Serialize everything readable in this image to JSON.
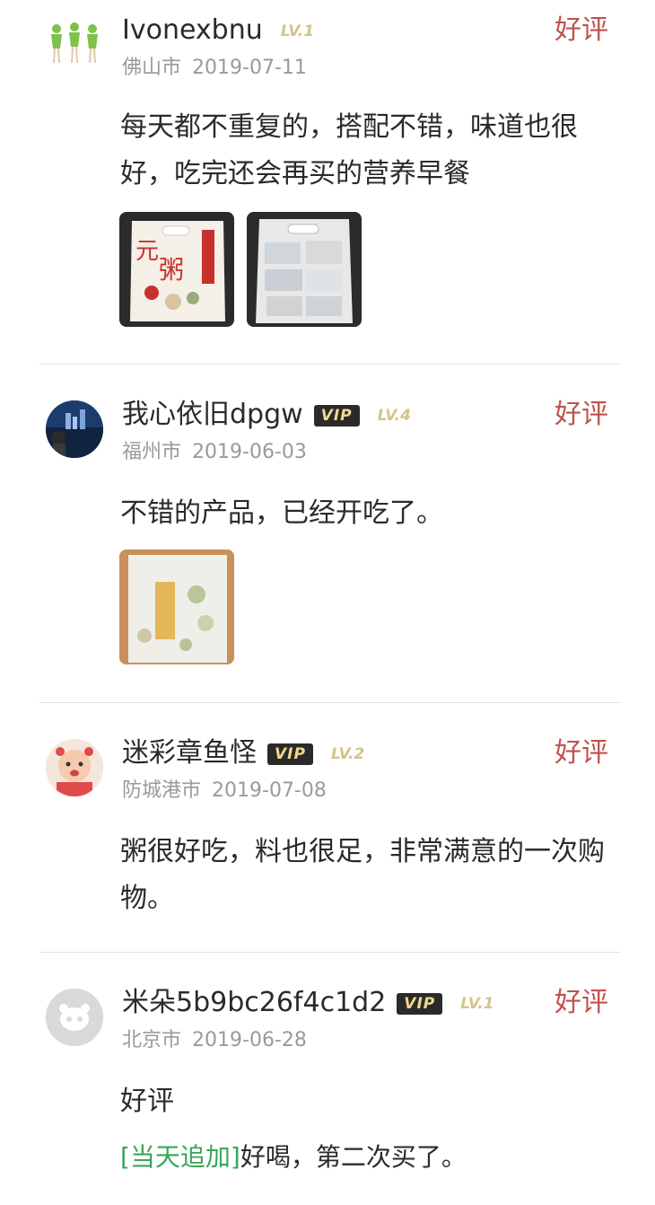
{
  "reviews": [
    {
      "username": "Ivonexbnu",
      "vip": "",
      "level": "LV.1",
      "city": "佛山市",
      "date": "2019-07-11",
      "rating": "好评",
      "text": "每天都不重复的，搭配不错，味道也很好，吃完还会再买的营养早餐"
    },
    {
      "username": "我心依旧dpgw",
      "vip": "VIP",
      "level": "LV.4",
      "city": "福州市",
      "date": "2019-06-03",
      "rating": "好评",
      "text": "不错的产品，已经开吃了。"
    },
    {
      "username": "迷彩章鱼怪",
      "vip": "VIP",
      "level": "LV.2",
      "city": "防城港市",
      "date": "2019-07-08",
      "rating": "好评",
      "text": "粥很好吃，料也很足，非常满意的一次购物。"
    },
    {
      "username": "米朵5b9bc26f4c1d2",
      "vip": "VIP",
      "level": "LV.1",
      "city": "北京市",
      "date": "2019-06-28",
      "rating": "好评",
      "text": "好评",
      "append_tag": "[当天追加]",
      "append_text": "好喝，第二次买了。"
    }
  ],
  "colors": {
    "rating": "#c0514d",
    "append_tag": "#3aa55a",
    "meta": "#9a9a9a"
  }
}
